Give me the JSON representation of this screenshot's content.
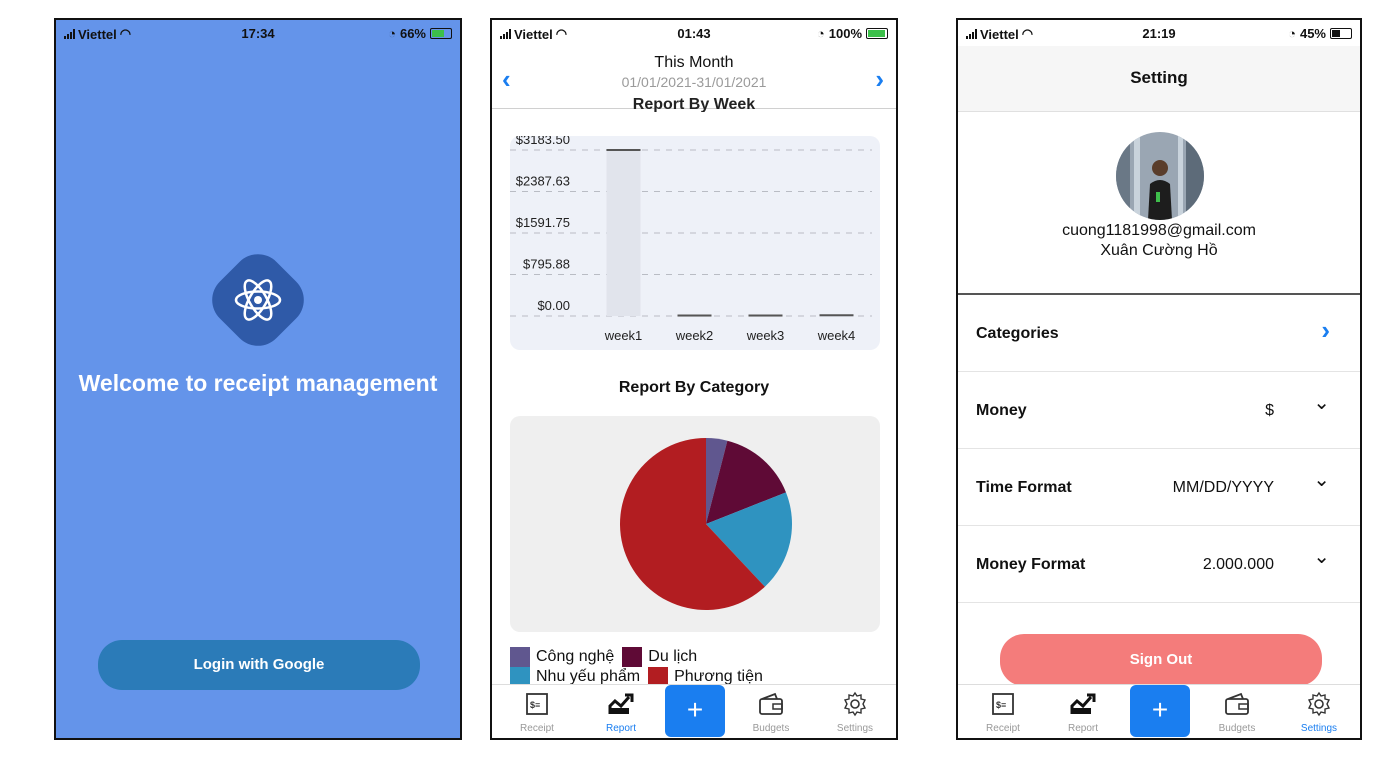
{
  "screen1": {
    "status": {
      "carrier": "Viettel",
      "time": "17:34",
      "battery": "66%"
    },
    "welcome": "Welcome to receipt management",
    "login_label": "Login with Google",
    "bg_color": "#6494ea",
    "button_color": "#2b7bb8"
  },
  "screen2": {
    "status": {
      "carrier": "Viettel",
      "time": "01:43",
      "battery": "100%"
    },
    "header": {
      "title": "This Month",
      "range": "01/01/2021-31/01/2021"
    },
    "week_chart_title": "Report By Week",
    "category_chart_title": "Report By Category",
    "chart_data": [
      {
        "type": "bar",
        "title": "Report By Week",
        "categories": [
          "week1",
          "week2",
          "week3",
          "week4"
        ],
        "values": [
          3183.5,
          10,
          10,
          15
        ],
        "y_ticks": [
          "$0.00",
          "$795.88",
          "$1591.75",
          "$2387.63",
          "$3183.50"
        ],
        "ylim": [
          0,
          3183.5
        ],
        "grid": true
      },
      {
        "type": "pie",
        "title": "Report By Category",
        "categories": [
          "Công nghệ",
          "Du lịch",
          "Nhu yếu phẩm",
          "Phương tiện"
        ],
        "values": [
          4,
          15,
          19,
          62
        ],
        "colors": [
          "#60578f",
          "#5f0a36",
          "#2f93c0",
          "#b21d21"
        ]
      }
    ],
    "tabs": [
      {
        "label": "Receipt",
        "icon": "receipt-icon"
      },
      {
        "label": "Report",
        "icon": "report-icon"
      },
      {
        "label": "",
        "icon": "plus-icon"
      },
      {
        "label": "Budgets",
        "icon": "wallet-icon"
      },
      {
        "label": "Settings",
        "icon": "gear-icon"
      }
    ],
    "active_tab": "Report",
    "accent": "#1a7ef0"
  },
  "screen3": {
    "status": {
      "carrier": "Viettel",
      "time": "21:19",
      "battery": "45%"
    },
    "title": "Setting",
    "email": "cuong1181998@gmail.com",
    "name": "Xuân Cường Hồ",
    "rows": [
      {
        "label": "Categories",
        "value": "",
        "control": "›"
      },
      {
        "label": "Money",
        "value": "$",
        "control": "⌄"
      },
      {
        "label": "Time Format",
        "value": "MM/DD/YYYY",
        "control": "⌄"
      },
      {
        "label": "Money Format",
        "value": "2.000.000",
        "control": "⌄"
      }
    ],
    "sign_out_label": "Sign Out",
    "tabs": [
      {
        "label": "Receipt"
      },
      {
        "label": "Report"
      },
      {
        "label": ""
      },
      {
        "label": "Budgets"
      },
      {
        "label": "Settings"
      }
    ],
    "active_tab": "Settings",
    "sign_out_color": "#f47c7b"
  }
}
